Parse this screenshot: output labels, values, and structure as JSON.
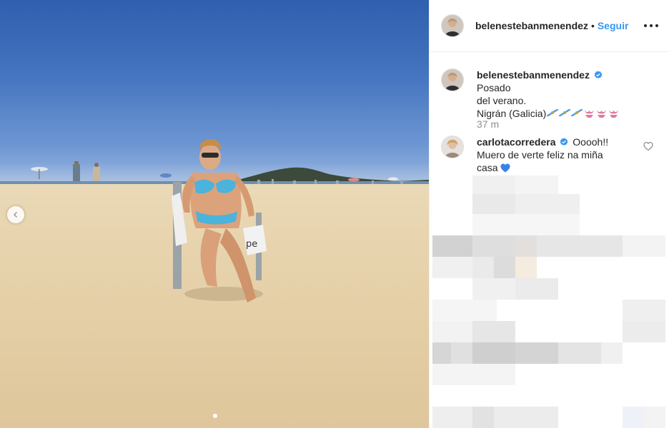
{
  "post": {
    "username": "belenestebanmenendez",
    "follow_label": "Seguir",
    "separator": "•"
  },
  "caption": {
    "username": "belenestebanmenendez",
    "text_line1": "Posado",
    "text_line2": "del verano.",
    "text_line3": "Nigrán (Galicia)",
    "time": "37 m"
  },
  "comments": [
    {
      "username": "carlotacorredera",
      "text_line1": "Ooooh!!",
      "text_line2": "Muero de verte feliz na miña",
      "text_line3": "casa"
    }
  ],
  "colors": {
    "accent": "#3897f0",
    "verified": "#3897f0",
    "text": "#262626",
    "muted": "#8e8e8e"
  },
  "icons": [
    "chevron-left-icon",
    "more-options-icon",
    "verified-badge-icon",
    "heart-outline-icon",
    "bikini-emoji",
    "galicia-flag-emoji",
    "blue-heart-emoji"
  ],
  "carousel": {
    "dots": 2,
    "active_index": 0
  }
}
